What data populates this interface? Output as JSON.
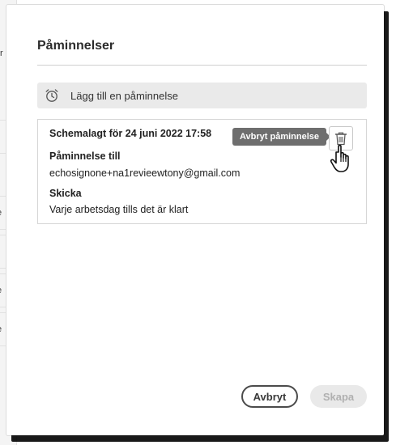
{
  "background_fragments": [
    "r",
    "e",
    "t",
    "e",
    "e"
  ],
  "dialog": {
    "title": "Påminnelser",
    "add_reminder_label": "Lägg till en påminnelse",
    "reminder": {
      "scheduled": "Schemalagt för 24 juni 2022 17:58",
      "reminder_to_label": "Påminnelse till",
      "reminder_to_value": "echosignone+na1revieewtony@gmail.com",
      "send_label": "Skicka",
      "send_value": "Varje arbetsdag tills det är klart",
      "tooltip": "Avbryt påminnelse"
    },
    "buttons": {
      "cancel": "Avbryt",
      "create": "Skapa"
    }
  },
  "icons": {
    "alarm": "alarm-clock-icon",
    "trash": "trash-icon",
    "cursor": "hand-pointer-cursor-icon"
  },
  "colors": {
    "tooltip_bg": "#6e6e6e",
    "add_row_bg": "#eaeaea",
    "create_disabled_bg": "#e9e9e9"
  }
}
